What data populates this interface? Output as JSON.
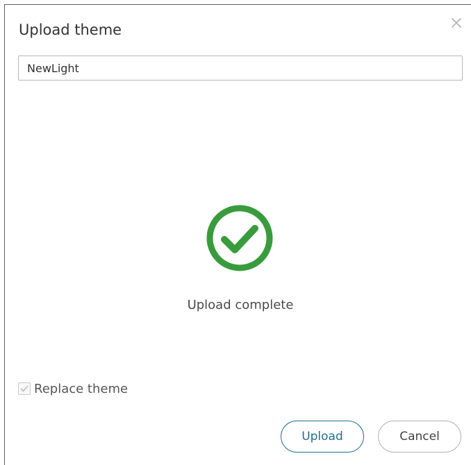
{
  "dialog": {
    "title": "Upload theme",
    "close_icon": "close-icon",
    "theme_name_value": "NewLight",
    "status": {
      "icon": "check-circle-icon",
      "text": "Upload complete",
      "color": "#3a9b3d"
    },
    "replace_theme": {
      "label": "Replace theme",
      "checked": true,
      "disabled": true
    },
    "buttons": {
      "upload_label": "Upload",
      "cancel_label": "Cancel"
    },
    "colors": {
      "accent": "#1f6f90",
      "success": "#3a9b3d"
    }
  }
}
